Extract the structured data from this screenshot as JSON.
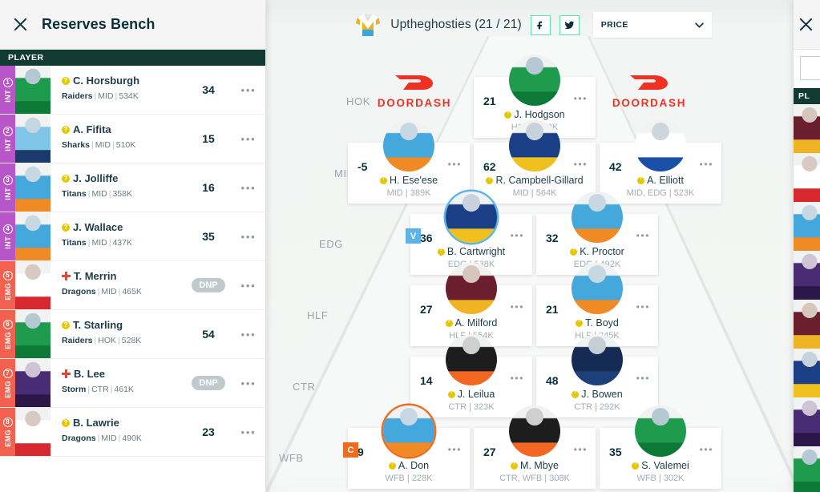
{
  "left_panel": {
    "title": "Reserves Bench",
    "close_icon": "close-icon",
    "column_header": "PLAYER",
    "rows": [
      {
        "num": "1",
        "tag": "INT",
        "rail": "int",
        "status": "question",
        "name": "C. Horsburgh",
        "team": "Raiders",
        "pos": "MID",
        "price": "534K",
        "points": "34",
        "dnp": false,
        "jersey": "raiders",
        "menu": "•••"
      },
      {
        "num": "2",
        "tag": "INT",
        "rail": "int",
        "status": "question",
        "name": "A. Fifita",
        "team": "Sharks",
        "pos": "MID",
        "price": "510K",
        "points": "15",
        "dnp": false,
        "jersey": "sharks",
        "menu": "•••"
      },
      {
        "num": "3",
        "tag": "INT",
        "rail": "int",
        "status": "question",
        "name": "J. Jolliffe",
        "team": "Titans",
        "pos": "MID",
        "price": "358K",
        "points": "16",
        "dnp": false,
        "jersey": "titans",
        "menu": "•••"
      },
      {
        "num": "4",
        "tag": "INT",
        "rail": "int",
        "status": "question",
        "name": "J. Wallace",
        "team": "Titans",
        "pos": "MID",
        "price": "437K",
        "points": "35",
        "dnp": false,
        "jersey": "titans",
        "menu": "•••"
      },
      {
        "num": "5",
        "tag": "EMG",
        "rail": "emg",
        "status": "injury",
        "name": "T. Merrin",
        "team": "Dragons",
        "pos": "MID",
        "price": "465K",
        "points": "DNP",
        "dnp": true,
        "jersey": "dragons",
        "menu": "•••"
      },
      {
        "num": "6",
        "tag": "EMG",
        "rail": "emg",
        "status": "question",
        "name": "T. Starling",
        "team": "Raiders",
        "pos": "HOK",
        "price": "528K",
        "points": "54",
        "dnp": false,
        "jersey": "raiders",
        "menu": "•••"
      },
      {
        "num": "7",
        "tag": "EMG",
        "rail": "emg",
        "status": "injury",
        "name": "B. Lee",
        "team": "Storm",
        "pos": "CTR",
        "price": "461K",
        "points": "DNP",
        "dnp": true,
        "jersey": "storm",
        "menu": "•••"
      },
      {
        "num": "8",
        "tag": "EMG",
        "rail": "emg",
        "status": "question",
        "name": "B. Lawrie",
        "team": "Dragons",
        "pos": "MID",
        "price": "490K",
        "points": "23",
        "dnp": false,
        "jersey": "dragons",
        "menu": "•••"
      }
    ]
  },
  "topbar": {
    "team_icon": "jersey-icon",
    "team_label": "Uptheghosties (21 / 21)",
    "facebook_label": "f",
    "twitter_label": "t",
    "sort_selected": "PRICE",
    "chevron": "chevron-down-icon"
  },
  "field": {
    "position_labels": [
      "HOK",
      "MID",
      "EDG",
      "HLF",
      "CTR",
      "WFB"
    ],
    "sponsors": [
      {
        "word": "DOORDASH",
        "color": "#ef3124"
      },
      {
        "word": "DOORDASH",
        "color": "#ef3124"
      }
    ],
    "players": [
      {
        "slot": "HOK",
        "score": "21",
        "name": "J. Hodgson",
        "meta": "HOK | 569K",
        "jersey": "raiders",
        "badge": "",
        "status": "question",
        "menu": "•••"
      },
      {
        "slot": "MID",
        "score": "-5",
        "name": "H. Ese'ese",
        "meta": "MID | 389K",
        "jersey": "titans",
        "badge": "",
        "status": "question",
        "menu": "•••"
      },
      {
        "slot": "MID",
        "score": "62",
        "name": "R. Campbell-Gillard",
        "meta": "MID | 564K",
        "jersey": "eels",
        "badge": "",
        "status": "question",
        "menu": "•••"
      },
      {
        "slot": "MID",
        "score": "42",
        "name": "A. Elliott",
        "meta": "MID, EDG | 523K",
        "jersey": "bulldogs",
        "badge": "",
        "status": "question",
        "menu": "•••"
      },
      {
        "slot": "EDG",
        "score": "36",
        "name": "B. Cartwright",
        "meta": "EDG | 538K",
        "jersey": "eels",
        "badge": "V",
        "status": "question",
        "menu": "•••"
      },
      {
        "slot": "EDG",
        "score": "32",
        "name": "K. Proctor",
        "meta": "EDG | 492K",
        "jersey": "titans",
        "badge": "",
        "status": "question",
        "menu": "•••"
      },
      {
        "slot": "HLF",
        "score": "27",
        "name": "A. Milford",
        "meta": "HLF | 554K",
        "jersey": "broncos",
        "badge": "",
        "status": "question",
        "menu": "•••"
      },
      {
        "slot": "HLF",
        "score": "21",
        "name": "T. Boyd",
        "meta": "HLF | 345K",
        "jersey": "titans",
        "badge": "",
        "status": "question",
        "menu": "•••"
      },
      {
        "slot": "CTR",
        "score": "14",
        "name": "J. Leilua",
        "meta": "CTR | 323K",
        "jersey": "tigers",
        "badge": "",
        "status": "question",
        "menu": "•••"
      },
      {
        "slot": "CTR",
        "score": "48",
        "name": "J. Bowen",
        "meta": "CTR | 292K",
        "jersey": "cowboys",
        "badge": "",
        "status": "question",
        "menu": "•••"
      },
      {
        "slot": "WFB",
        "score": "9",
        "name": "A. Don",
        "meta": "WFB | 228K",
        "jersey": "titans",
        "badge": "C",
        "status": "question",
        "menu": "•••"
      },
      {
        "slot": "WFB",
        "score": "27",
        "name": "M. Mbye",
        "meta": "CTR, WFB | 308K",
        "jersey": "tigers",
        "badge": "",
        "status": "question",
        "menu": "•••"
      },
      {
        "slot": "WFB",
        "score": "35",
        "name": "S. Valemei",
        "meta": "WFB | 302K",
        "jersey": "raiders",
        "badge": "",
        "status": "question",
        "menu": "•••"
      }
    ]
  },
  "right_panel": {
    "close_icon": "close-icon",
    "column_header": "PL"
  },
  "colors": {
    "accent_green": "#113a33",
    "int_rail": "#b855c8",
    "emg_rail": "#f4604f",
    "captain": "#ee6c20",
    "vice_captain": "#5eb4e8",
    "sponsor_red": "#ef3124",
    "status_yellow": "#e3c800",
    "injury_red": "#f0402f"
  }
}
